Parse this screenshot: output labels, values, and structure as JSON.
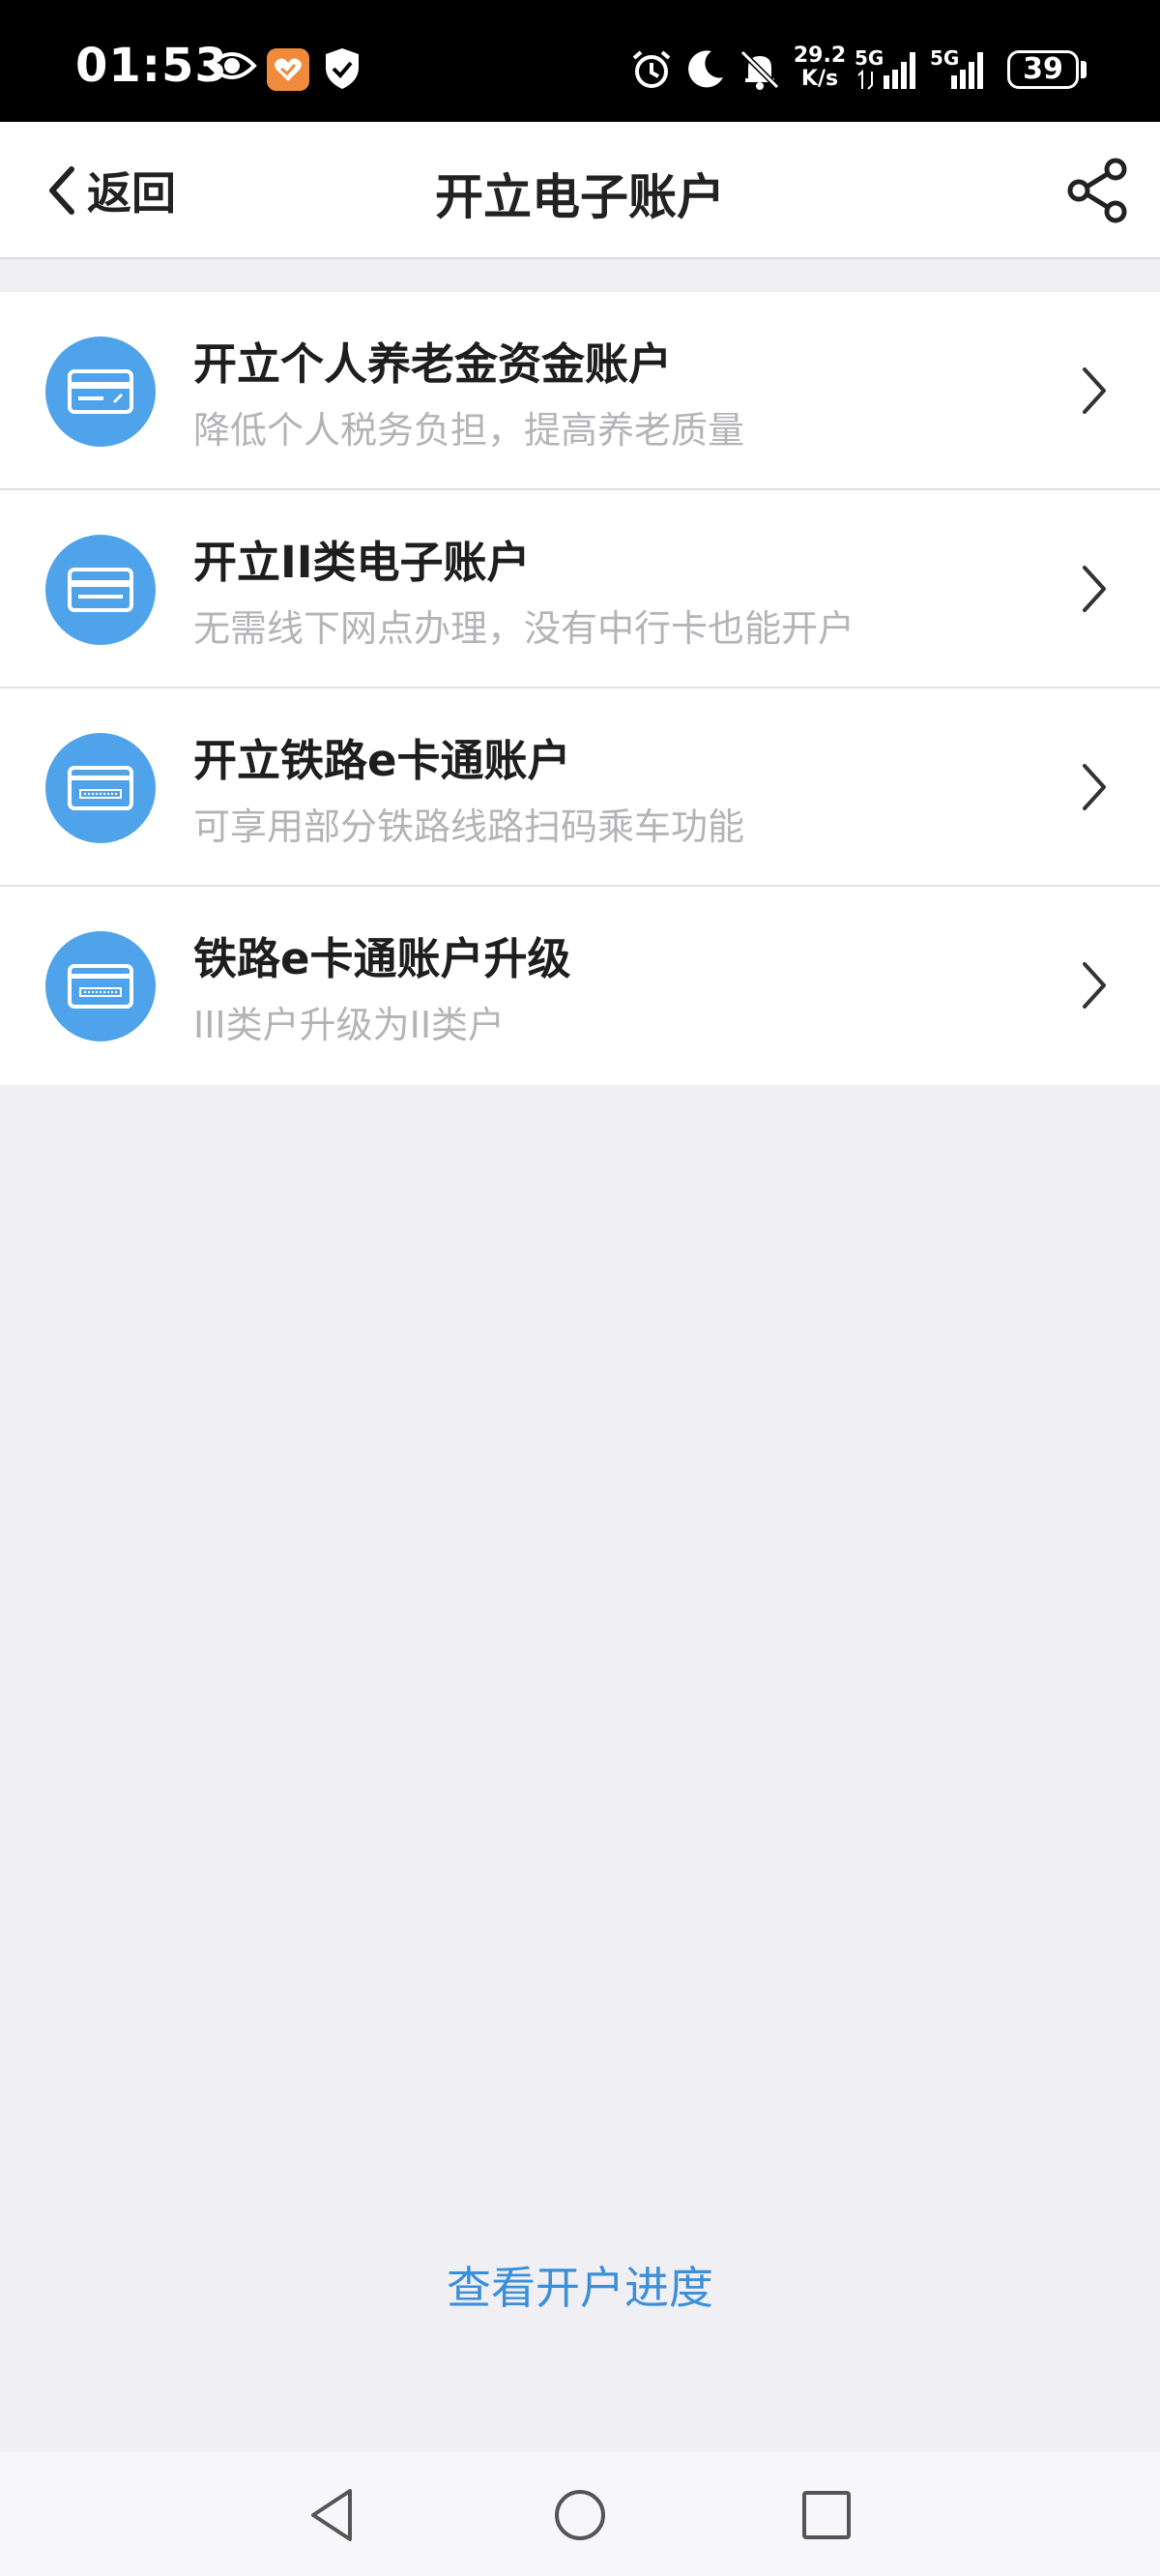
{
  "status_bar": {
    "time": "01:53",
    "net_speed_value": "29.2",
    "net_speed_unit": "K/s",
    "signal1_label": "5G",
    "signal2_label": "5G",
    "battery": "39",
    "icons": [
      "eye-icon",
      "health-app-icon",
      "shield-check-icon",
      "alarm-icon",
      "moon-icon",
      "bell-off-icon",
      "signal-icon",
      "signal-icon",
      "battery-icon"
    ]
  },
  "nav": {
    "back_label": "返回",
    "title": "开立电子账户"
  },
  "items": [
    {
      "title": "开立个人养老金资金账户",
      "subtitle": "降低个人税务负担，提高养老质量"
    },
    {
      "title": "开立II类电子账户",
      "subtitle": "无需线下网点办理，没有中行卡也能开户"
    },
    {
      "title": "开立铁路e卡通账户",
      "subtitle": "可享用部分铁路线路扫码乘车功能"
    },
    {
      "title": "铁路e卡通账户升级",
      "subtitle": "III类户升级为II类户"
    }
  ],
  "progress_link": "查看开户进度",
  "colors": {
    "accent": "#4fa3ea",
    "link": "#3b8fd8",
    "background": "#efeff4"
  }
}
